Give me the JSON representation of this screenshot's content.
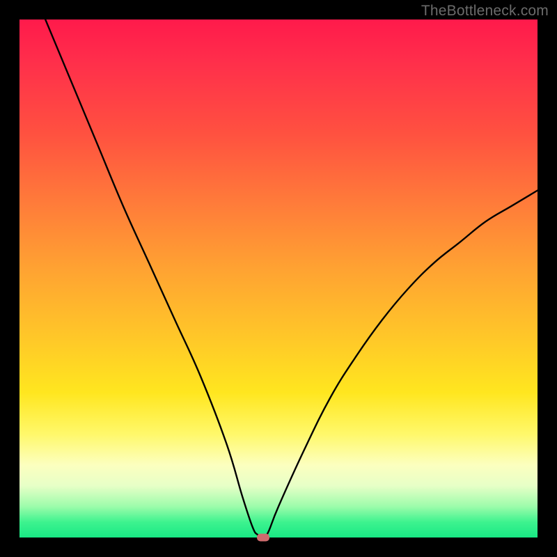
{
  "watermark": "TheBottleneck.com",
  "chart_data": {
    "type": "line",
    "title": "",
    "xlabel": "",
    "ylabel": "",
    "xlim": [
      0,
      100
    ],
    "ylim": [
      0,
      100
    ],
    "grid": false,
    "legend": false,
    "series": [
      {
        "name": "bottleneck-curve",
        "x": [
          5,
          10,
          15,
          20,
          25,
          30,
          35,
          40,
          43,
          45,
          46,
          47,
          48,
          50,
          55,
          60,
          65,
          70,
          75,
          80,
          85,
          90,
          95,
          100
        ],
        "y": [
          100,
          88,
          76,
          64,
          53,
          42,
          31,
          18,
          8,
          2,
          0.5,
          0,
          1,
          6,
          17,
          27,
          35,
          42,
          48,
          53,
          57,
          61,
          64,
          67
        ]
      }
    ],
    "marker": {
      "x": 47,
      "y": 0,
      "color": "#ce6b6e"
    },
    "background_gradient": {
      "top": "#ff1a4b",
      "mid": "#ffe61f",
      "bottom": "#18e884"
    }
  }
}
